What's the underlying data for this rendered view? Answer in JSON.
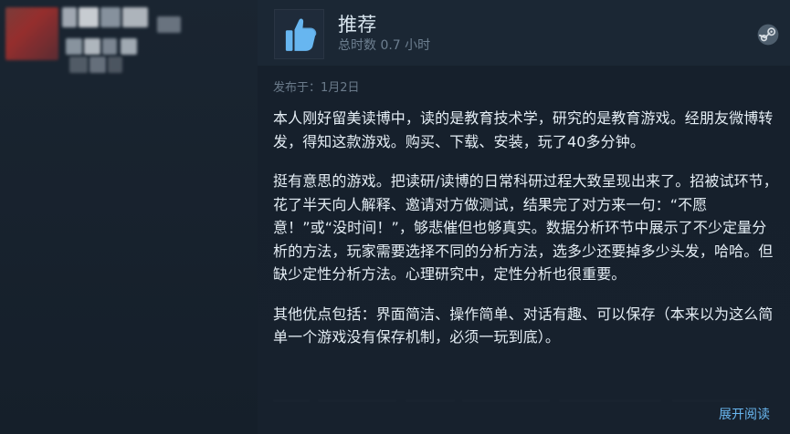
{
  "review": {
    "recommendation": "推荐",
    "hours": "总时数 0.7 小时",
    "posted": "发布于：1月2日",
    "paragraphs": [
      "本人刚好留美读博中，读的是教育技术学，研究的是教育游戏。经朋友微博转发，得知这款游戏。购买、下载、安装，玩了40多分钟。",
      "挺有意思的游戏。把读研/读博的日常科研过程大致呈现出来了。招被试环节，花了半天向人解释、邀请对方做测试，结果完了对方来一句：“不愿意！”或“没时间！”，够悲催但也够真实。数据分析环节中展示了不少定量分析的方法，玩家需要选择不同的分析方法，选多少还要掉多少头发，哈哈。但缺少定性分析方法。心理研究中，定性分析也很重要。",
      "其他优点包括：界面简洁、操作简单、对话有趣、可以保存（本来以为这么简单一个游戏没有保存机制，必须一玩到底）。"
    ],
    "expand_label": "展开阅读"
  },
  "icons": {
    "recommendation": "thumbs-up-icon",
    "platform": "steam-icon"
  },
  "colors": {
    "accent": "#69b7f0",
    "thumb": "#67b6f0",
    "background": "#17212d"
  }
}
